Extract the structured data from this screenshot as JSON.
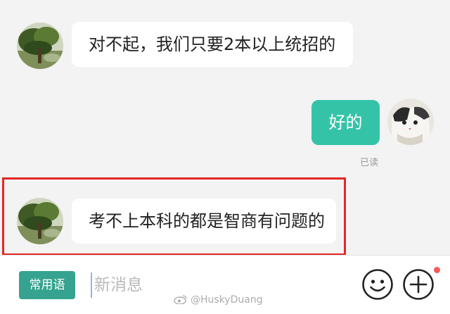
{
  "messages": [
    {
      "sender": "other",
      "text": "对不起，我们只要2本以上统招的"
    },
    {
      "sender": "me",
      "text": "好的",
      "status": "已读"
    },
    {
      "sender": "other",
      "text": "考不上本科的都是智商有问题的"
    }
  ],
  "input_bar": {
    "phrases_label": "常用语",
    "placeholder": "新消息"
  },
  "watermark": "@HuskyDuang",
  "colors": {
    "my_bubble": "#35c3a8",
    "phrases_button": "#35a38f",
    "highlight_border": "#e32626",
    "notification_dot": "#f35a5a"
  },
  "icons": [
    "tree-avatar",
    "cat-avatar",
    "emoji-icon",
    "plus-icon",
    "weibo-icon"
  ]
}
